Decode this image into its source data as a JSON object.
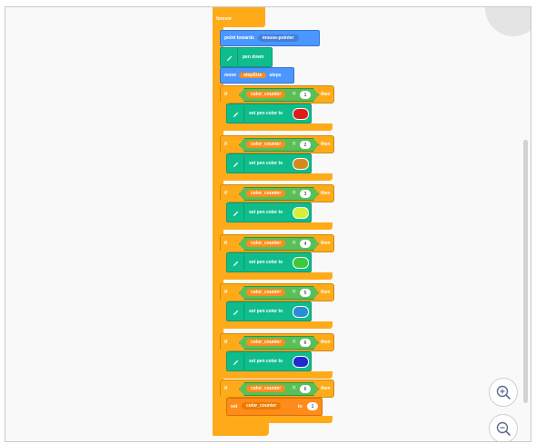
{
  "script": {
    "hat_label": "forever",
    "point_towards": {
      "label": "point towards",
      "target": "mouse-pointer"
    },
    "pen_down": {
      "label": "pen down"
    },
    "move": {
      "label": "move",
      "var": "stepSize",
      "unit": "steps"
    },
    "if_blocks": [
      {
        "if_label": "if",
        "var": "color_counter",
        "op": "=",
        "value": "1",
        "then_label": "then",
        "body": "set pen color to",
        "color": "#e01b1b"
      },
      {
        "if_label": "if",
        "var": "color_counter",
        "op": "=",
        "value": "2",
        "then_label": "then",
        "body": "set pen color to",
        "color": "#d58a1e"
      },
      {
        "if_label": "if",
        "var": "color_counter",
        "op": "=",
        "value": "3",
        "then_label": "then",
        "body": "set pen color to",
        "color": "#d6f03a"
      },
      {
        "if_label": "if",
        "var": "color_counter",
        "op": "=",
        "value": "4",
        "then_label": "then",
        "body": "set pen color to",
        "color": "#3cc93c"
      },
      {
        "if_label": "if",
        "var": "color_counter",
        "op": "=",
        "value": "5",
        "then_label": "then",
        "body": "set pen color to",
        "color": "#2a8bd6"
      },
      {
        "if_label": "if",
        "var": "color_counter",
        "op": "=",
        "value": "6",
        "then_label": "then",
        "body": "set pen color to",
        "color": "#1f2ad0"
      }
    ],
    "last_if": {
      "if_label": "if",
      "var": "color_counter",
      "op": "=",
      "value": "6",
      "then_label": "then",
      "set_label": "set",
      "set_var": "color_counter",
      "to_label": "to",
      "set_value": "1"
    }
  },
  "icons": {
    "pen": "pen-icon",
    "zoom_in": "zoom-in-icon",
    "zoom_out": "zoom-out-icon"
  },
  "colors": {
    "motion": "#4c97ff",
    "pen": "#0fbd8c",
    "control": "#ffab19",
    "operator": "#59c059",
    "variable": "#ff8c1a"
  }
}
